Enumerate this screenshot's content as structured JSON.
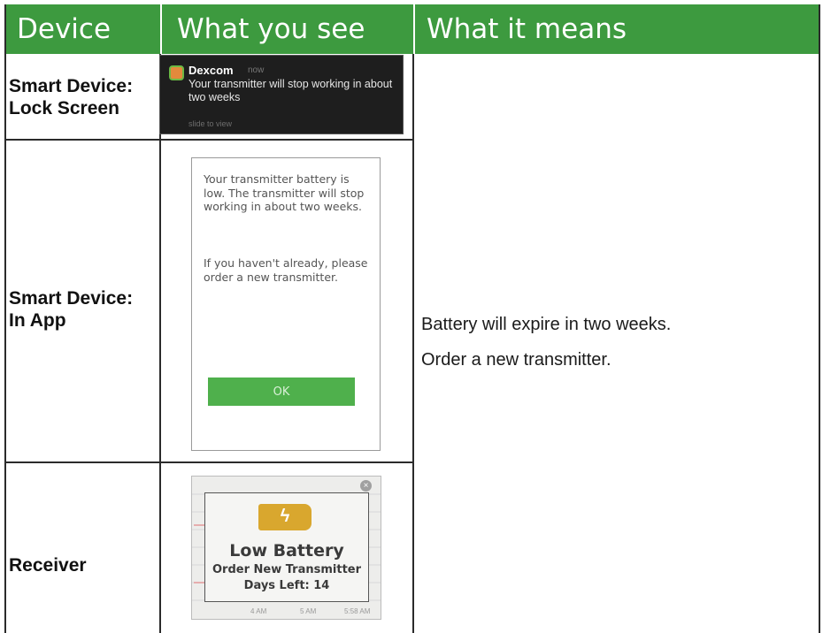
{
  "table": {
    "headers": [
      "Device",
      "What you see",
      "What it means"
    ],
    "rows": [
      {
        "device": "Smart Device:\nLock Screen"
      },
      {
        "device": "Smart Device:\nIn App"
      },
      {
        "device": "Receiver"
      }
    ],
    "meaning": [
      "Battery will expire in two weeks.",
      "Order a new transmitter."
    ]
  },
  "lock_screen": {
    "app_name": "Dexcom",
    "time": "now",
    "message": "Your transmitter will stop working in about two weeks",
    "hint": "slide to view",
    "icon": "dexcom-app-icon"
  },
  "in_app": {
    "paragraph1": "Your transmitter battery is low. The transmitter will stop working in about two weeks.",
    "paragraph2": "If you haven't already, please order a new transmitter.",
    "ok_label": "OK",
    "ok_color": "#4fb04c"
  },
  "receiver": {
    "icon": "low-battery-icon",
    "title": "Low Battery",
    "subtitle": "Order New Transmitter",
    "days_left": "Days Left: 14",
    "time_labels": [
      "4 AM",
      "5 AM",
      "5:58 AM"
    ],
    "battery_color": "#d9a72e"
  },
  "colors": {
    "header_bg": "#3d9a3f",
    "header_text": "#ffffff",
    "border": "#2b2b2b"
  }
}
